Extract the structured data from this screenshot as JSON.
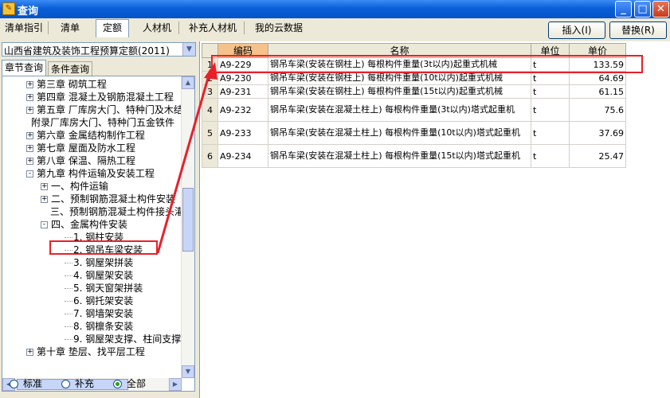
{
  "window": {
    "title": "查询",
    "min": "_",
    "max": "□",
    "close": "✕"
  },
  "tabs": [
    "清单指引",
    "清单",
    "定额",
    "人材机",
    "补充人材机",
    "我的云数据"
  ],
  "buttons": {
    "insert": "插入(I)",
    "replace": "替换(R)"
  },
  "left": {
    "quota_select": "山西省建筑及装饰工程预算定额(2011)",
    "subtabs": [
      "章节查询",
      "条件查询"
    ],
    "tree": [
      {
        "text": "第三章  砌筑工程",
        "exp": "+"
      },
      {
        "text": "第四章  混凝土及钢筋混凝土工程",
        "exp": "+"
      },
      {
        "text": "第五章  厂库房大门、特种门及木结",
        "exp": "+"
      },
      {
        "text": "附录厂库房大门、特种门五金铁件",
        "exp": ""
      },
      {
        "text": "第六章  金属结构制作工程",
        "exp": "+"
      },
      {
        "text": "第七章  屋面及防水工程",
        "exp": "+"
      },
      {
        "text": "第八章  保温、隔热工程",
        "exp": "+"
      },
      {
        "text": "第九章  构件运输及安装工程",
        "exp": "-"
      },
      {
        "text": "一、构件运输",
        "exp": "+"
      },
      {
        "text": "二、预制钢筋混凝土构件安装",
        "exp": "+"
      },
      {
        "text": "三、预制钢筋混凝土构件接头灌",
        "exp": ""
      },
      {
        "text": "四、金属构件安装",
        "exp": "-"
      },
      {
        "text": "1. 钢柱安装",
        "exp": ""
      },
      {
        "text": "2. 钢吊车梁安装",
        "exp": ""
      },
      {
        "text": "3. 钢屋架拼装",
        "exp": ""
      },
      {
        "text": "4. 钢屋架安装",
        "exp": ""
      },
      {
        "text": "5. 钢天窗架拼装",
        "exp": ""
      },
      {
        "text": "6. 钢托架安装",
        "exp": ""
      },
      {
        "text": "7. 钢墙架安装",
        "exp": ""
      },
      {
        "text": "8. 钢檩条安装",
        "exp": ""
      },
      {
        "text": "9. 钢屋架支撑、柱间支撑安",
        "exp": ""
      },
      {
        "text": "第十章  垫层、找平层工程",
        "exp": "+"
      }
    ],
    "radios": [
      "标准",
      "补充",
      "全部"
    ],
    "selected_radio": "全部"
  },
  "table": {
    "headers": [
      "",
      "编码",
      "名称",
      "单位",
      "单价"
    ],
    "rows": [
      {
        "idx": "1",
        "code": "A9-229",
        "name": "钢吊车梁(安装在钢柱上) 每根构件重量(3t以内)起重式机械",
        "unit": "t",
        "price": "133.59"
      },
      {
        "idx": "2",
        "code": "A9-230",
        "name": "钢吊车梁(安装在钢柱上) 每根构件重量(10t以内)起重式机械",
        "unit": "t",
        "price": "64.69"
      },
      {
        "idx": "3",
        "code": "A9-231",
        "name": "钢吊车梁(安装在钢柱上) 每根构件重量(15t以内)起重式机械",
        "unit": "t",
        "price": "61.15"
      },
      {
        "idx": "4",
        "code": "A9-232",
        "name": "钢吊车梁(安装在混凝土柱上) 每根构件重量(3t以内)塔式起重机",
        "unit": "t",
        "price": "75.6"
      },
      {
        "idx": "5",
        "code": "A9-233",
        "name": "钢吊车梁(安装在混凝土柱上) 每根构件重量(10t以内)塔式起重机",
        "unit": "t",
        "price": "37.69"
      },
      {
        "idx": "6",
        "code": "A9-234",
        "name": "钢吊车梁(安装在混凝土柱上) 每根构件重量(15t以内)塔式起重机",
        "unit": "t",
        "price": "25.47"
      }
    ]
  },
  "colors": {
    "annotation": "#e8202a",
    "titlebar": "#0a5fd6",
    "code_header": "#f5c28b"
  }
}
